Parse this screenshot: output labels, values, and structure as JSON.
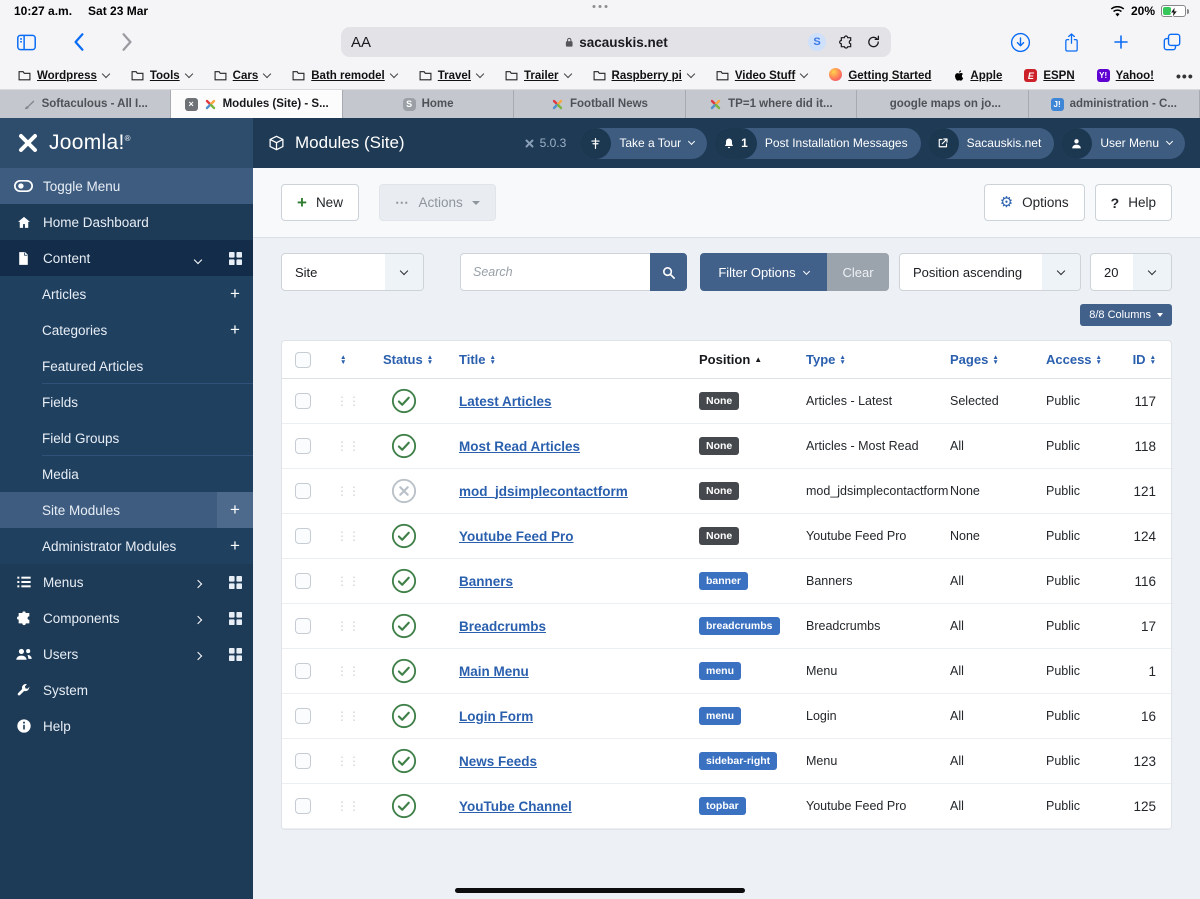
{
  "status_bar": {
    "time": "10:27 a.m.",
    "date": "Sat 23 Mar",
    "battery": "20%"
  },
  "browser": {
    "reader_label": "AA",
    "url": "sacauskis.net",
    "bookmarks": [
      {
        "label": "Wordpress",
        "icon": "folder",
        "caret": true
      },
      {
        "label": "Tools",
        "icon": "folder",
        "caret": true
      },
      {
        "label": "Cars",
        "icon": "folder",
        "caret": true
      },
      {
        "label": "Bath remodel",
        "icon": "folder",
        "caret": true
      },
      {
        "label": "Travel",
        "icon": "folder",
        "caret": true
      },
      {
        "label": "Trailer",
        "icon": "folder",
        "caret": true
      },
      {
        "label": "Raspberry pi",
        "icon": "folder",
        "caret": true
      },
      {
        "label": "Video Stuff",
        "icon": "folder",
        "caret": true
      },
      {
        "label": "Getting Started",
        "icon": "gradient"
      },
      {
        "label": "Apple",
        "icon": "apple"
      },
      {
        "label": "ESPN",
        "icon": "espn"
      },
      {
        "label": "Yahoo!",
        "icon": "yahoo"
      }
    ],
    "tabs": [
      {
        "title": "Softaculous - All I...",
        "icon": "softaculous",
        "state": "inactive"
      },
      {
        "title": "Modules (Site) - S...",
        "icon": "joomla-color",
        "state": "active",
        "closable": true
      },
      {
        "title": "Home",
        "icon": "s-gray",
        "state": "inactive"
      },
      {
        "title": "Football News",
        "icon": "joomla-color",
        "state": "inactive"
      },
      {
        "title": "TP=1 where did it...",
        "icon": "joomla-color",
        "state": "inactive"
      },
      {
        "title": "google maps on jo...",
        "icon": "google",
        "state": "inactive"
      },
      {
        "title": "administration - C...",
        "icon": "jadmin",
        "state": "inactive"
      }
    ]
  },
  "admin_header": {
    "logo": "Joomla!",
    "logo_mark": "®",
    "page_title": "Modules (Site)",
    "version": "5.0.3",
    "pills": [
      {
        "label": "Take a Tour",
        "icon": "signpost",
        "caret": true
      },
      {
        "label": "Post Installation Messages",
        "icon": "bell",
        "count": "1"
      },
      {
        "label": "Sacauskis.net",
        "icon": "extlink"
      },
      {
        "label": "User Menu",
        "icon": "person",
        "caret": true
      }
    ]
  },
  "sidebar": {
    "items": [
      {
        "label": "Toggle Menu",
        "icon": "toggle",
        "type": "top",
        "state": "highlight"
      },
      {
        "label": "Home Dashboard",
        "icon": "home",
        "type": "top"
      },
      {
        "label": "Content",
        "icon": "document",
        "type": "top",
        "state": "dark",
        "chevron": "down",
        "grid": true
      },
      {
        "label": "Articles",
        "type": "sub",
        "plus": true
      },
      {
        "label": "Categories",
        "type": "sub",
        "plus": true
      },
      {
        "label": "Featured Articles",
        "type": "sub",
        "divider": "divider"
      },
      {
        "label": "Fields",
        "type": "sub"
      },
      {
        "label": "Field Groups",
        "type": "sub",
        "divider": "divider"
      },
      {
        "label": "Media",
        "type": "sub"
      },
      {
        "label": "Site Modules",
        "type": "sub",
        "state": "active",
        "plus": true
      },
      {
        "label": "Administrator Modules",
        "type": "sub",
        "plus": true
      },
      {
        "label": "Menus",
        "icon": "menus",
        "type": "top",
        "chevron": "right",
        "grid": true
      },
      {
        "label": "Components",
        "icon": "puzzle",
        "type": "top",
        "chevron": "right",
        "grid": true
      },
      {
        "label": "Users",
        "icon": "users",
        "type": "top",
        "chevron": "right",
        "grid": true
      },
      {
        "label": "System",
        "icon": "wrench",
        "type": "top"
      },
      {
        "label": "Help",
        "icon": "info",
        "type": "top"
      }
    ]
  },
  "toolbar": {
    "new_label": "New",
    "actions_label": "Actions",
    "options_label": "Options",
    "help_label": "Help"
  },
  "filters": {
    "site_select": "Site",
    "search_placeholder": "Search",
    "filter_options_label": "Filter Options",
    "clear_label": "Clear",
    "sort_select": "Position ascending",
    "limit_select": "20",
    "columns_label": "8/8 Columns"
  },
  "table": {
    "columns": {
      "status": "Status",
      "title": "Title",
      "position": "Position",
      "type": "Type",
      "pages": "Pages",
      "access": "Access",
      "id": "ID"
    },
    "rows": [
      {
        "status": "published",
        "title": "Latest Articles",
        "position": "None",
        "badge": "dark",
        "type": "Articles - Latest",
        "pages": "Selected",
        "access": "Public",
        "id": "117"
      },
      {
        "status": "published",
        "title": "Most Read Articles",
        "position": "None",
        "badge": "dark",
        "type": "Articles - Most Read",
        "pages": "All",
        "access": "Public",
        "id": "118"
      },
      {
        "status": "unpublished",
        "title": "mod_jdsimplecontactform",
        "position": "None",
        "badge": "dark",
        "type": "mod_jdsimplecontactform",
        "pages": "None",
        "access": "Public",
        "id": "121"
      },
      {
        "status": "published",
        "title": "Youtube Feed Pro",
        "position": "None",
        "badge": "dark",
        "type": "Youtube Feed Pro",
        "pages": "None",
        "access": "Public",
        "id": "124"
      },
      {
        "status": "published",
        "title": "Banners",
        "position": "banner",
        "badge": "blue",
        "type": "Banners",
        "pages": "All",
        "access": "Public",
        "id": "116"
      },
      {
        "status": "published",
        "title": "Breadcrumbs",
        "position": "breadcrumbs",
        "badge": "blue",
        "type": "Breadcrumbs",
        "pages": "All",
        "access": "Public",
        "id": "17"
      },
      {
        "status": "published",
        "title": "Main Menu",
        "position": "menu",
        "badge": "blue",
        "type": "Menu",
        "pages": "All",
        "access": "Public",
        "id": "1"
      },
      {
        "status": "published",
        "title": "Login Form",
        "position": "menu",
        "badge": "blue",
        "type": "Login",
        "pages": "All",
        "access": "Public",
        "id": "16"
      },
      {
        "status": "published",
        "title": "News Feeds",
        "position": "sidebar-right",
        "badge": "blue",
        "type": "Menu",
        "pages": "All",
        "access": "Public",
        "id": "123"
      },
      {
        "status": "published",
        "title": "YouTube Channel",
        "position": "topbar",
        "badge": "blue",
        "type": "Youtube Feed Pro",
        "pages": "All",
        "access": "Public",
        "id": "125"
      }
    ]
  }
}
